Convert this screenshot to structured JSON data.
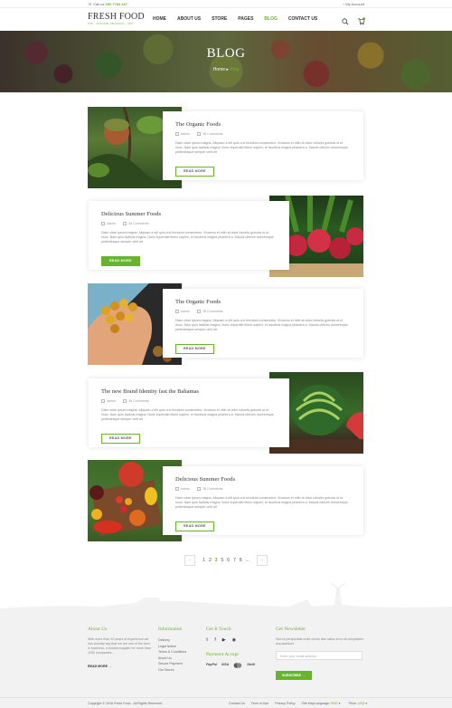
{
  "topbar": {
    "call_label": "Call us",
    "call_number": "090 7784 437",
    "account_label": "My Account"
  },
  "header": {
    "logo_main": "FRESH FOOD",
    "logo_tag": "100 · NATURE ORGANIC · 100",
    "nav": [
      "HOME",
      "ABOUT US",
      "STORE",
      "PAGES",
      "BLOG",
      "CONTACT US"
    ],
    "active_nav": "BLOG",
    "icons": [
      "search-icon",
      "cart-icon"
    ]
  },
  "hero": {
    "title": "BLOG",
    "crumb_home": "Home",
    "crumb_sep": "▸",
    "crumb_current": "Blog"
  },
  "posts": [
    {
      "title": "The Organic Foods",
      "author": "Admin",
      "comments": "36 Comments",
      "excerpt": "Diam vitae ipsum magna. Aliquam a elit quis orci tincidunt consectetur. Vivamus et nibh at dolor lobortis gravida ut ut risus. Nam quis facilisis magna. Nunc imperdiet libero sapien, et faucibus magna pharetra a. Mauris ultrices doloremque pellentesque semper velit vel",
      "button": "READ MORE",
      "image": "persimmon-tree"
    },
    {
      "title": "Delicious Summer Foods",
      "author": "Admin",
      "comments": "36 Comments",
      "excerpt": "Diam vitae ipsum magna. Aliquam a elit quis orci tincidunt consectetur. Vivamus et nibh at dolor lobortis gravida ut ut risus. Nam quis facilisis magna. Nunc imperdiet libero sapien, et faucibus magna pharetra a. Mauris ultrices doloremque pellentesque semper velit vel",
      "button": "READ MORE",
      "image": "radishes"
    },
    {
      "title": "The Organic Foods",
      "author": "Admin",
      "comments": "36 Comments",
      "excerpt": "Diam vitae ipsum magna. Aliquam a elit quis orci tincidunt consectetur. Vivamus et nibh at dolor lobortis gravida ut ut risus. Nam quis facilisis magna. Nunc imperdiet libero sapien, et faucibus magna pharetra a. Mauris ultrices doloremque pellentesque semper velit vel",
      "button": "READ MORE",
      "image": "berries-in-hand"
    },
    {
      "title": "The new Brand Identity fast the Bahamas",
      "author": "Admin",
      "comments": "36 Comments",
      "excerpt": "Diam vitae ipsum magna. Aliquam a elit quis orci tincidunt consectetur. Vivamus et nibh at dolor lobortis gravida ut ut risus. Nam quis facilisis magna. Nunc imperdiet libero sapien, et faucibus magna pharetra a. Mauris ultrices doloremque pellentesque semper velit vel",
      "button": "READ MORE",
      "image": "watermelon"
    },
    {
      "title": "Delicious Summer Foods",
      "author": "Admin",
      "comments": "36 Comments",
      "excerpt": "Diam vitae ipsum magna. Aliquam a elit quis orci tincidunt consectetur. Vivamus et nibh at dolor lobortis gravida ut ut risus. Nam quis facilisis magna. Nunc imperdiet libero sapien, et faucibus magna pharetra a. Mauris ultrices doloremque pellentesque semper velit vel",
      "button": "READ MORE",
      "image": "tomatoes"
    }
  ],
  "pagination": {
    "prev": "‹",
    "next": "›",
    "pages": [
      "1",
      "2",
      "3",
      "5",
      "6",
      "7",
      "8",
      "..."
    ],
    "active": "3"
  },
  "footer": {
    "about": {
      "title": "About Us",
      "text": "With more than 20 years of experience we can proudly say that we are one of the best in business, a trusted supplier for more than 1000 companies...",
      "link": "READ MORE"
    },
    "information": {
      "title": "Information",
      "items": [
        "Delivery",
        "Legal Notice",
        "Terms & Conditions",
        "About Us",
        "Secure Payment",
        "Our Stores"
      ]
    },
    "touch": {
      "title": "Get It Touch",
      "social": [
        "twitter-icon",
        "facebook-icon",
        "youtube-icon",
        "rss-icon"
      ],
      "payment_title": "Payment Accept",
      "payments": [
        "PayPal",
        "VISA",
        "Mastercard",
        "Skrill"
      ]
    },
    "newsletter": {
      "title": "Get Newsletter",
      "text": "Sed ut perspiciatis unde omnis iste natus error sit voluptatem accusantium",
      "placeholder": "Enter your email address",
      "button": "SUBSCRIBE"
    }
  },
  "bottombar": {
    "copyright": "Copyright © 2016 Fresh Food - All Rights Reserved",
    "links": [
      "Contact Us",
      "Term of Use",
      "Privacy Policy",
      "Site Map"
    ],
    "language_label": "Language",
    "language_value": "ENG",
    "price_label": "Price",
    "price_value": "USD"
  },
  "colors": {
    "accent": "#6ab42d",
    "text": "#333333",
    "footer_bg": "#f2f2f2"
  }
}
